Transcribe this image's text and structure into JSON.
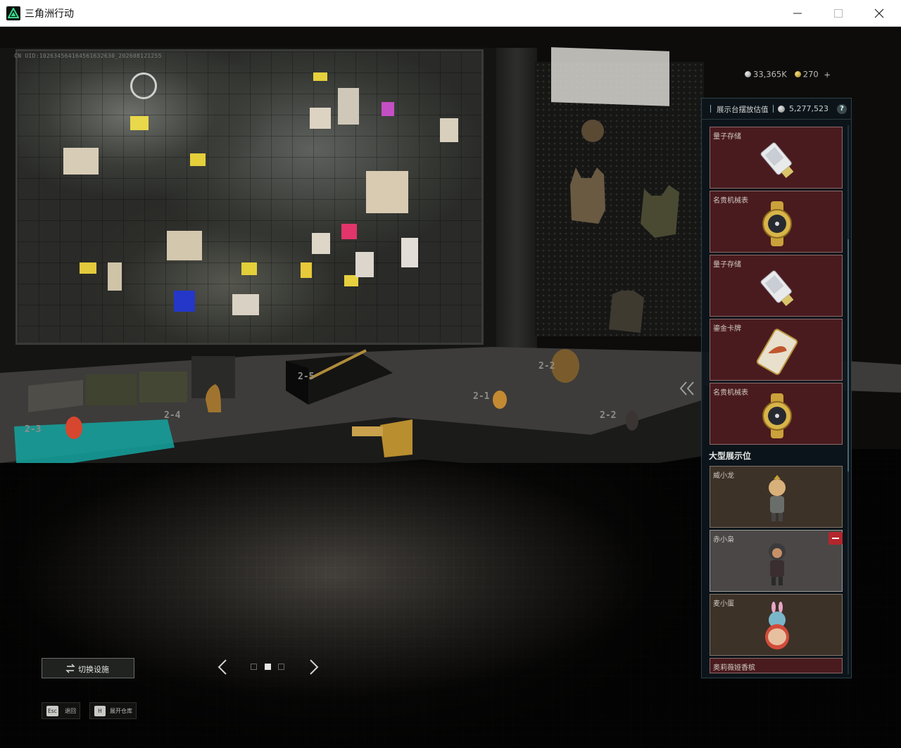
{
  "window": {
    "title": "三角洲行动"
  },
  "uid": "CN UID:102634564164561632630_202608121255",
  "currency": {
    "primary_amount": "33,365K",
    "secondary_amount": "270",
    "add_symbol": "+"
  },
  "panel": {
    "title": "展示台摆放估值",
    "value": "5,277,523",
    "help_symbol": "?",
    "slots": [
      {
        "name": "量子存储",
        "icon": "usb-drive-icon"
      },
      {
        "name": "名贵机械表",
        "icon": "gold-watch-icon"
      },
      {
        "name": "量子存储",
        "icon": "usb-drive-icon"
      },
      {
        "name": "鎏金卡牌",
        "icon": "gold-card-icon"
      },
      {
        "name": "名贵机械表",
        "icon": "gold-watch-icon"
      }
    ],
    "large_section_title": "大型展示位",
    "large_slots": [
      {
        "name": "威小龙",
        "icon": "figure-icon"
      },
      {
        "name": "赤小枭",
        "icon": "figure-icon"
      },
      {
        "name": "麦小蛋",
        "icon": "figure-egg-icon"
      },
      {
        "name": "奥莉薇娅香槟",
        "icon": "bottle-icon"
      }
    ]
  },
  "table_slot_labels": [
    "2-3",
    "2-4",
    "2-5",
    "2-1",
    "2-2",
    "2-2"
  ],
  "bottom": {
    "switch_button_label": "切换设施",
    "pages": {
      "total": 3,
      "current": 2
    },
    "hints": [
      {
        "key": "Esc",
        "label": "退回"
      },
      {
        "key": "H",
        "label": "展开仓库"
      }
    ]
  },
  "colors": {
    "accent_red": "#b3262c",
    "slot_red_bg": "#4a1b1e",
    "panel_bg": "#0c161c"
  }
}
